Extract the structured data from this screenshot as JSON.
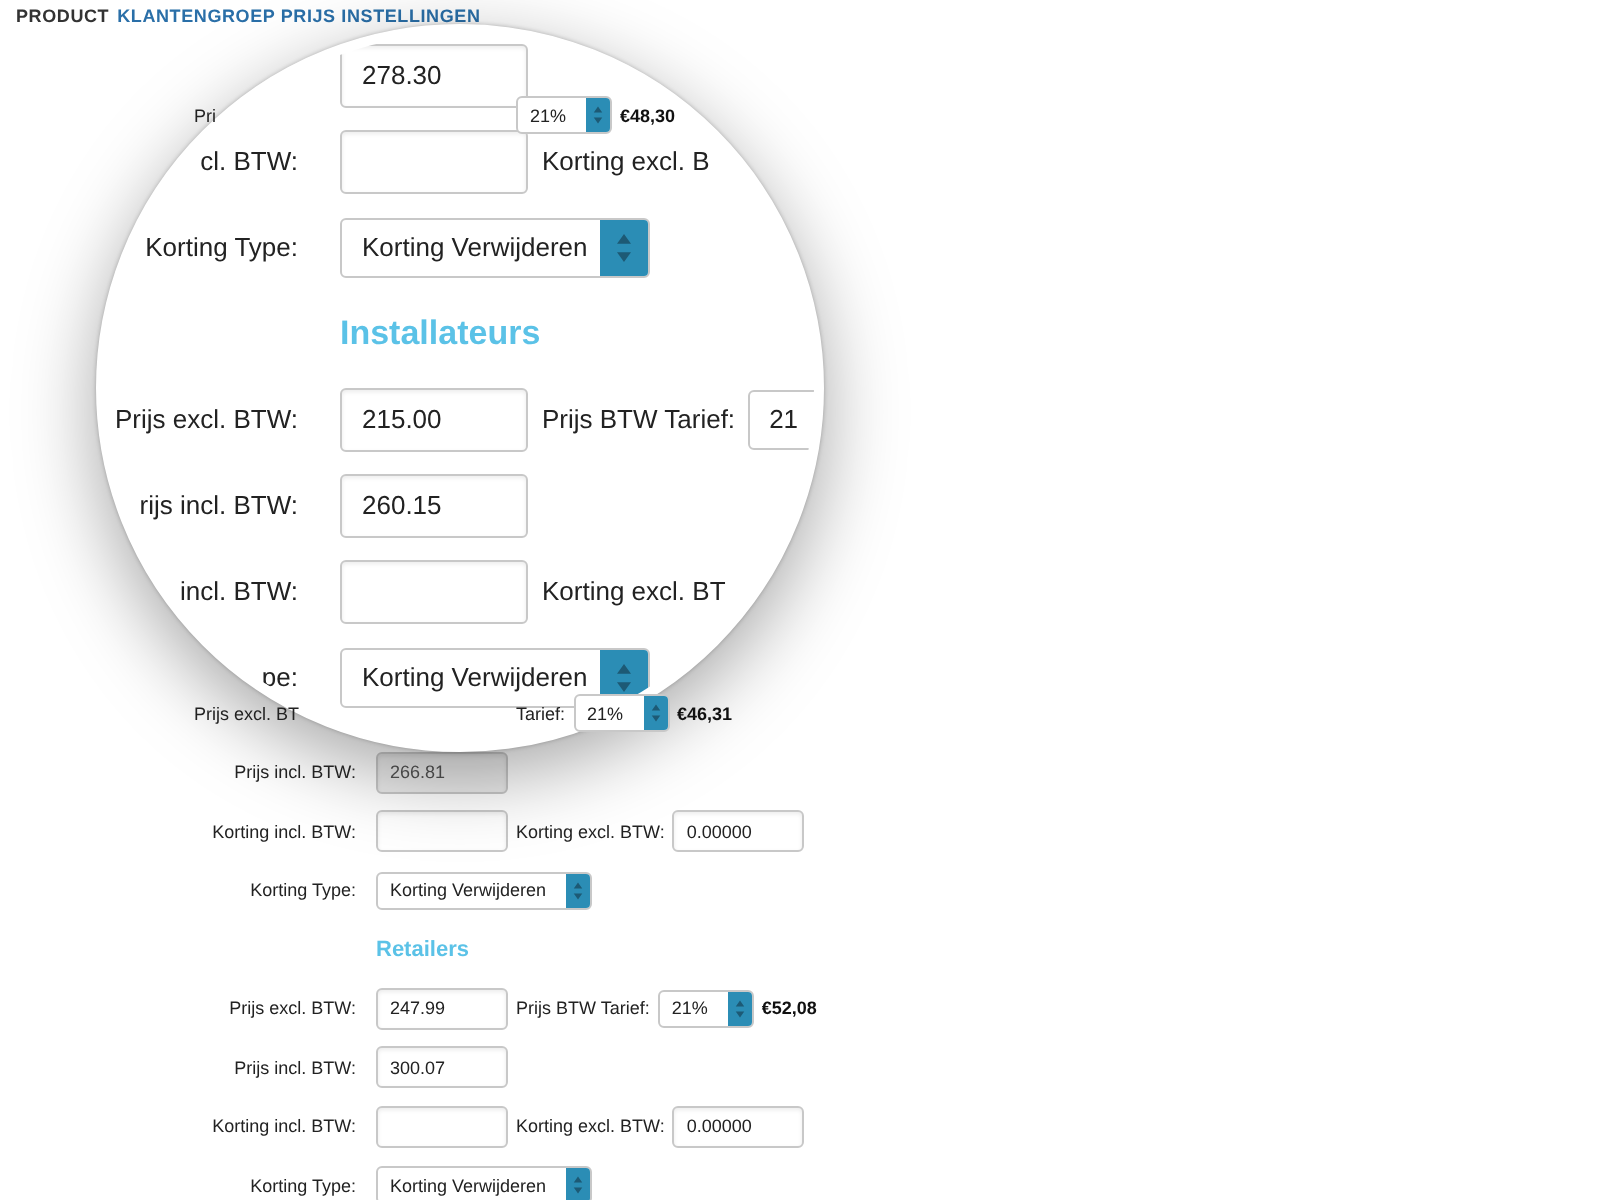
{
  "header": {
    "prefix": "PRODUCT",
    "title": "KLANTENGROEP PRIJS INSTELLINGEN"
  },
  "background": {
    "top_rows": [
      {
        "kind": "fields",
        "label": "Pri",
        "label_cut": true,
        "select": "21%",
        "price": "€48,30"
      }
    ],
    "rows": [
      {
        "kind": "fields",
        "label": "Prijs excl. BT",
        "label_cut": true,
        "label2": "Tarief:",
        "select": "21%",
        "price": "€46,31"
      },
      {
        "kind": "fields",
        "label": "Prijs incl. BTW:",
        "field": {
          "value": "266.81",
          "disabled": true
        }
      },
      {
        "kind": "fields",
        "label": "Korting incl. BTW:",
        "field": {
          "disabled": false
        },
        "label2": "Korting excl. BTW:",
        "field2": "0.00000"
      },
      {
        "kind": "fields",
        "label": "Korting Type:",
        "select_wide": "Korting Verwijderen"
      },
      {
        "kind": "heading",
        "heading": "Retailers"
      },
      {
        "kind": "fields",
        "label": "Prijs excl. BTW:",
        "field": {
          "value": "247.99",
          "disabled": false
        },
        "label2": "Prijs BTW Tarief:",
        "select": "21%",
        "price": "€52,08"
      },
      {
        "kind": "fields",
        "label": "Prijs incl. BTW:",
        "field": {
          "value": "300.07",
          "disabled": false
        }
      },
      {
        "kind": "fields",
        "label": "Korting incl. BTW:",
        "field": {
          "disabled": false
        },
        "label2": "Korting excl. BTW:",
        "field2": "0.00000"
      },
      {
        "kind": "fields",
        "label": "Korting Type:",
        "select_wide": "Korting Verwijderen"
      }
    ]
  },
  "magnifier": {
    "rows": [
      {
        "kind": "fields",
        "field": {
          "value": "278.30",
          "disabled": false
        }
      },
      {
        "kind": "fields",
        "label": "cl. BTW:",
        "field": {
          "disabled": false
        },
        "label2": "Korting excl. B"
      },
      {
        "kind": "fields",
        "label": "Korting Type:",
        "select_wide": "Korting Verwijderen"
      },
      {
        "kind": "heading",
        "heading": "Installateurs"
      },
      {
        "kind": "fields",
        "label": "Prijs excl. BTW:",
        "field": {
          "value": "215.00",
          "disabled": false
        },
        "label2": "Prijs BTW Tarief:",
        "select": "21"
      },
      {
        "kind": "fields",
        "label": "rijs incl. BTW:",
        "field": {
          "value": "260.15",
          "disabled": false
        }
      },
      {
        "kind": "fields",
        "label": "incl. BTW:",
        "field": {
          "disabled": false
        },
        "label2": "Korting excl. BT"
      },
      {
        "kind": "fields",
        "label": "pe:",
        "select_wide": "Korting Verwijderen"
      }
    ]
  }
}
